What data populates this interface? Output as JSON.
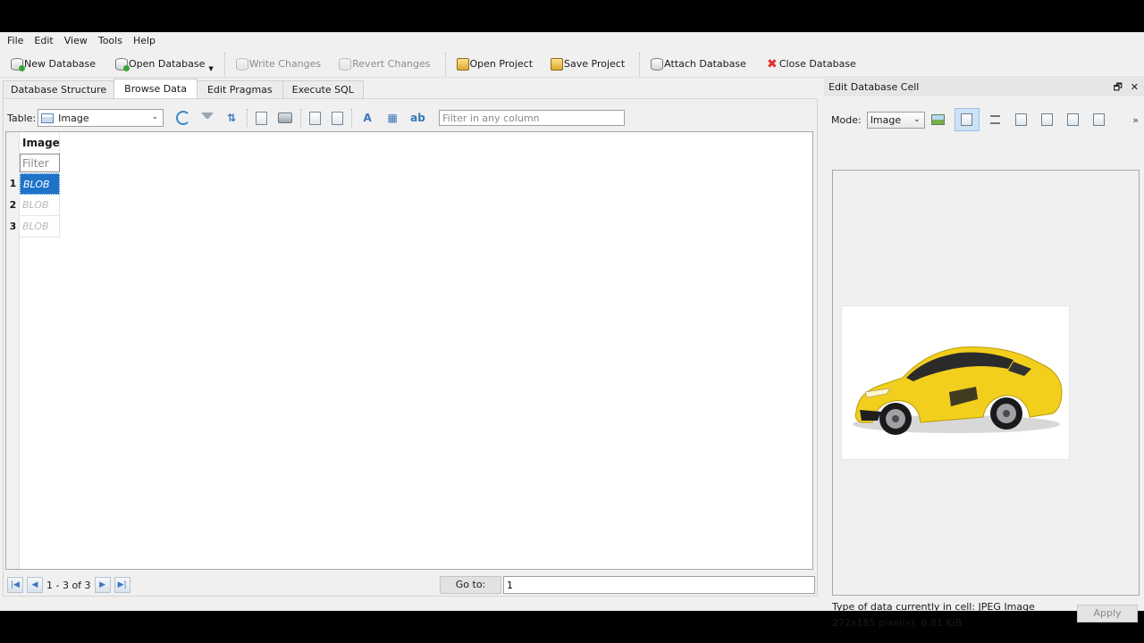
{
  "menu": [
    "File",
    "Edit",
    "View",
    "Tools",
    "Help"
  ],
  "toolbar": {
    "new_database": "New Database",
    "open_database": "Open Database",
    "write_changes": "Write Changes",
    "revert_changes": "Revert Changes",
    "open_project": "Open Project",
    "save_project": "Save Project",
    "attach_database": "Attach Database",
    "close_database": "Close Database"
  },
  "tabs": [
    "Database Structure",
    "Browse Data",
    "Edit Pragmas",
    "Execute SQL"
  ],
  "active_tab": "Browse Data",
  "browse": {
    "table_label": "Table:",
    "table_value": "Image",
    "global_filter_placeholder": "Filter in any column",
    "column_header": "Image",
    "column_filter_placeholder": "Filter",
    "rows": [
      {
        "num": "1",
        "value": "BLOB",
        "selected": true
      },
      {
        "num": "2",
        "value": "BLOB",
        "selected": false
      },
      {
        "num": "3",
        "value": "BLOB",
        "selected": false
      }
    ],
    "record_count": "1 - 3 of 3",
    "goto_label": "Go to:",
    "goto_value": "1"
  },
  "edit_cell": {
    "title": "Edit Database Cell",
    "float_icon": "🗗",
    "close_icon": "✕",
    "mode_label": "Mode:",
    "mode_value": "Image",
    "more_icon": "»",
    "type_info": "Type of data currently in cell: JPEG Image",
    "size_info": "272x185 pixel(s), 6.81 KiB",
    "apply_label": "Apply"
  },
  "colors": {
    "selection": "#1e73c8",
    "car_body": "#f2cf1d"
  }
}
